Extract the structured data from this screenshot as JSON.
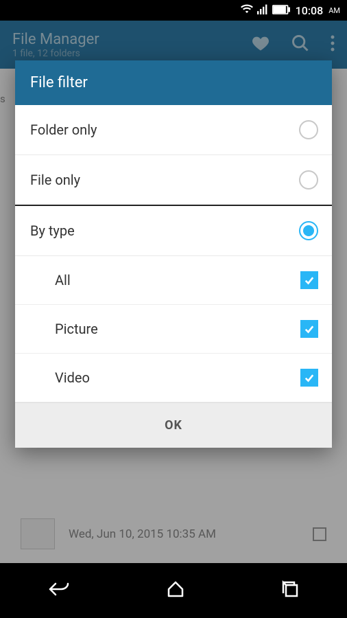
{
  "status": {
    "time": "10:08",
    "ampm": "AM"
  },
  "app": {
    "title": "File Manager",
    "subtitle": "1 file, 12 folders"
  },
  "background": {
    "left_char": "s",
    "date": "Wed, Jun 10, 2015 10:35 AM"
  },
  "dialog": {
    "title": "File filter",
    "options": [
      {
        "label": "Folder only",
        "selected": false
      },
      {
        "label": "File only",
        "selected": false
      },
      {
        "label": "By type",
        "selected": true
      }
    ],
    "sub_options": [
      {
        "label": "All",
        "checked": true
      },
      {
        "label": "Picture",
        "checked": true
      },
      {
        "label": "Video",
        "checked": true
      }
    ],
    "ok": "OK"
  }
}
